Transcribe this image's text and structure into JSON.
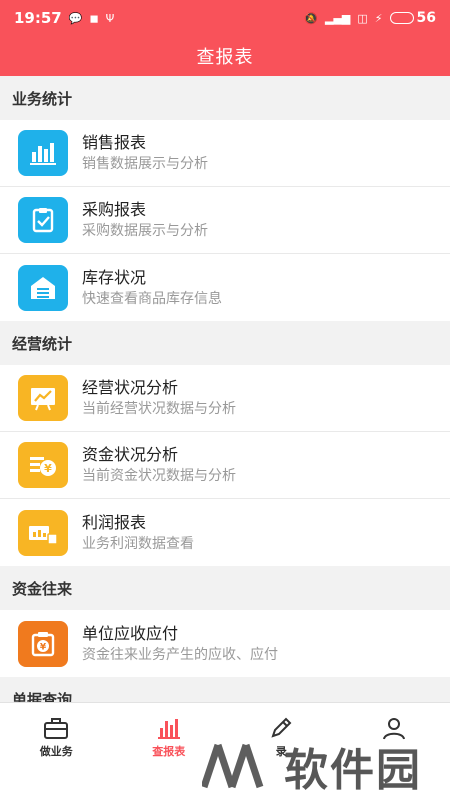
{
  "status_bar": {
    "time": "19:57",
    "battery": "56"
  },
  "header": {
    "title": "查报表"
  },
  "colors": {
    "header": "#f9525a",
    "blue_icon": "#1fb1ea",
    "orange_icon": "#f8b524",
    "deep_orange_icon": "#f07a1e"
  },
  "sections": [
    {
      "title": "业务统计",
      "items": [
        {
          "title": "销售报表",
          "subtitle": "销售数据展示与分析",
          "icon": "bar-chart-icon"
        },
        {
          "title": "采购报表",
          "subtitle": "采购数据展示与分析",
          "icon": "clipboard-check-icon"
        },
        {
          "title": "库存状况",
          "subtitle": "快速查看商品库存信息",
          "icon": "warehouse-icon"
        }
      ]
    },
    {
      "title": "经营统计",
      "items": [
        {
          "title": "经营状况分析",
          "subtitle": "当前经营状况数据与分析",
          "icon": "trend-board-icon"
        },
        {
          "title": "资金状况分析",
          "subtitle": "当前资金状况数据与分析",
          "icon": "yen-coin-icon"
        },
        {
          "title": "利润报表",
          "subtitle": "业务利润数据查看",
          "icon": "profit-chart-icon"
        }
      ]
    },
    {
      "title": "资金往来",
      "items": [
        {
          "title": "单位应收应付",
          "subtitle": "资金往来业务产生的应收、应付",
          "icon": "yen-clipboard-icon"
        }
      ]
    },
    {
      "title": "单据查询",
      "items": []
    }
  ],
  "tabs": [
    {
      "label": "做业务",
      "icon": "briefcase-icon"
    },
    {
      "label": "查报表",
      "icon": "bar-chart-icon"
    },
    {
      "label": "录",
      "icon": "pencil-icon"
    },
    {
      "label": "",
      "icon": "person-icon"
    }
  ],
  "watermark": {
    "text": "软件园"
  }
}
